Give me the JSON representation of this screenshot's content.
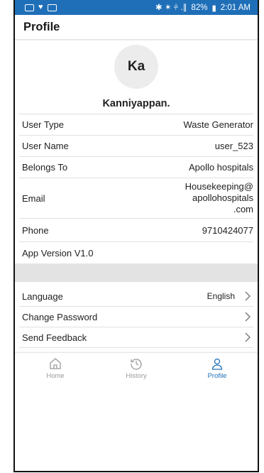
{
  "status_bar": {
    "battery": "82%",
    "time": "2:01 AM",
    "signal": "✱ ✶ ⫩ .∥"
  },
  "header": {
    "title": "Profile"
  },
  "profile": {
    "initials": "Ka",
    "name": "Kanniyappan.",
    "fields": [
      {
        "label": "User Type",
        "value": "Waste Generator"
      },
      {
        "label": "User Name",
        "value": "user_523"
      },
      {
        "label": "Belongs To",
        "value": "Apollo hospitals"
      },
      {
        "label": "Email",
        "value_lines": [
          "Housekeeping@",
          "apollohospitals",
          ".com"
        ]
      },
      {
        "label": "Phone",
        "value": "9710424077"
      }
    ],
    "app_version": "App Version V1.0"
  },
  "settings": [
    {
      "label": "Language",
      "value": "English"
    },
    {
      "label": "Change Password"
    },
    {
      "label": "Send Feedback"
    }
  ],
  "tabs": [
    {
      "label": "Home",
      "icon": "home-icon"
    },
    {
      "label": "History",
      "icon": "history-icon"
    },
    {
      "label": "Profile",
      "icon": "profile-icon",
      "active": true
    }
  ],
  "colors": {
    "accent": "#1f6fb8",
    "inactive": "#9a9a9a",
    "section_gap": "#e3e3e3"
  }
}
